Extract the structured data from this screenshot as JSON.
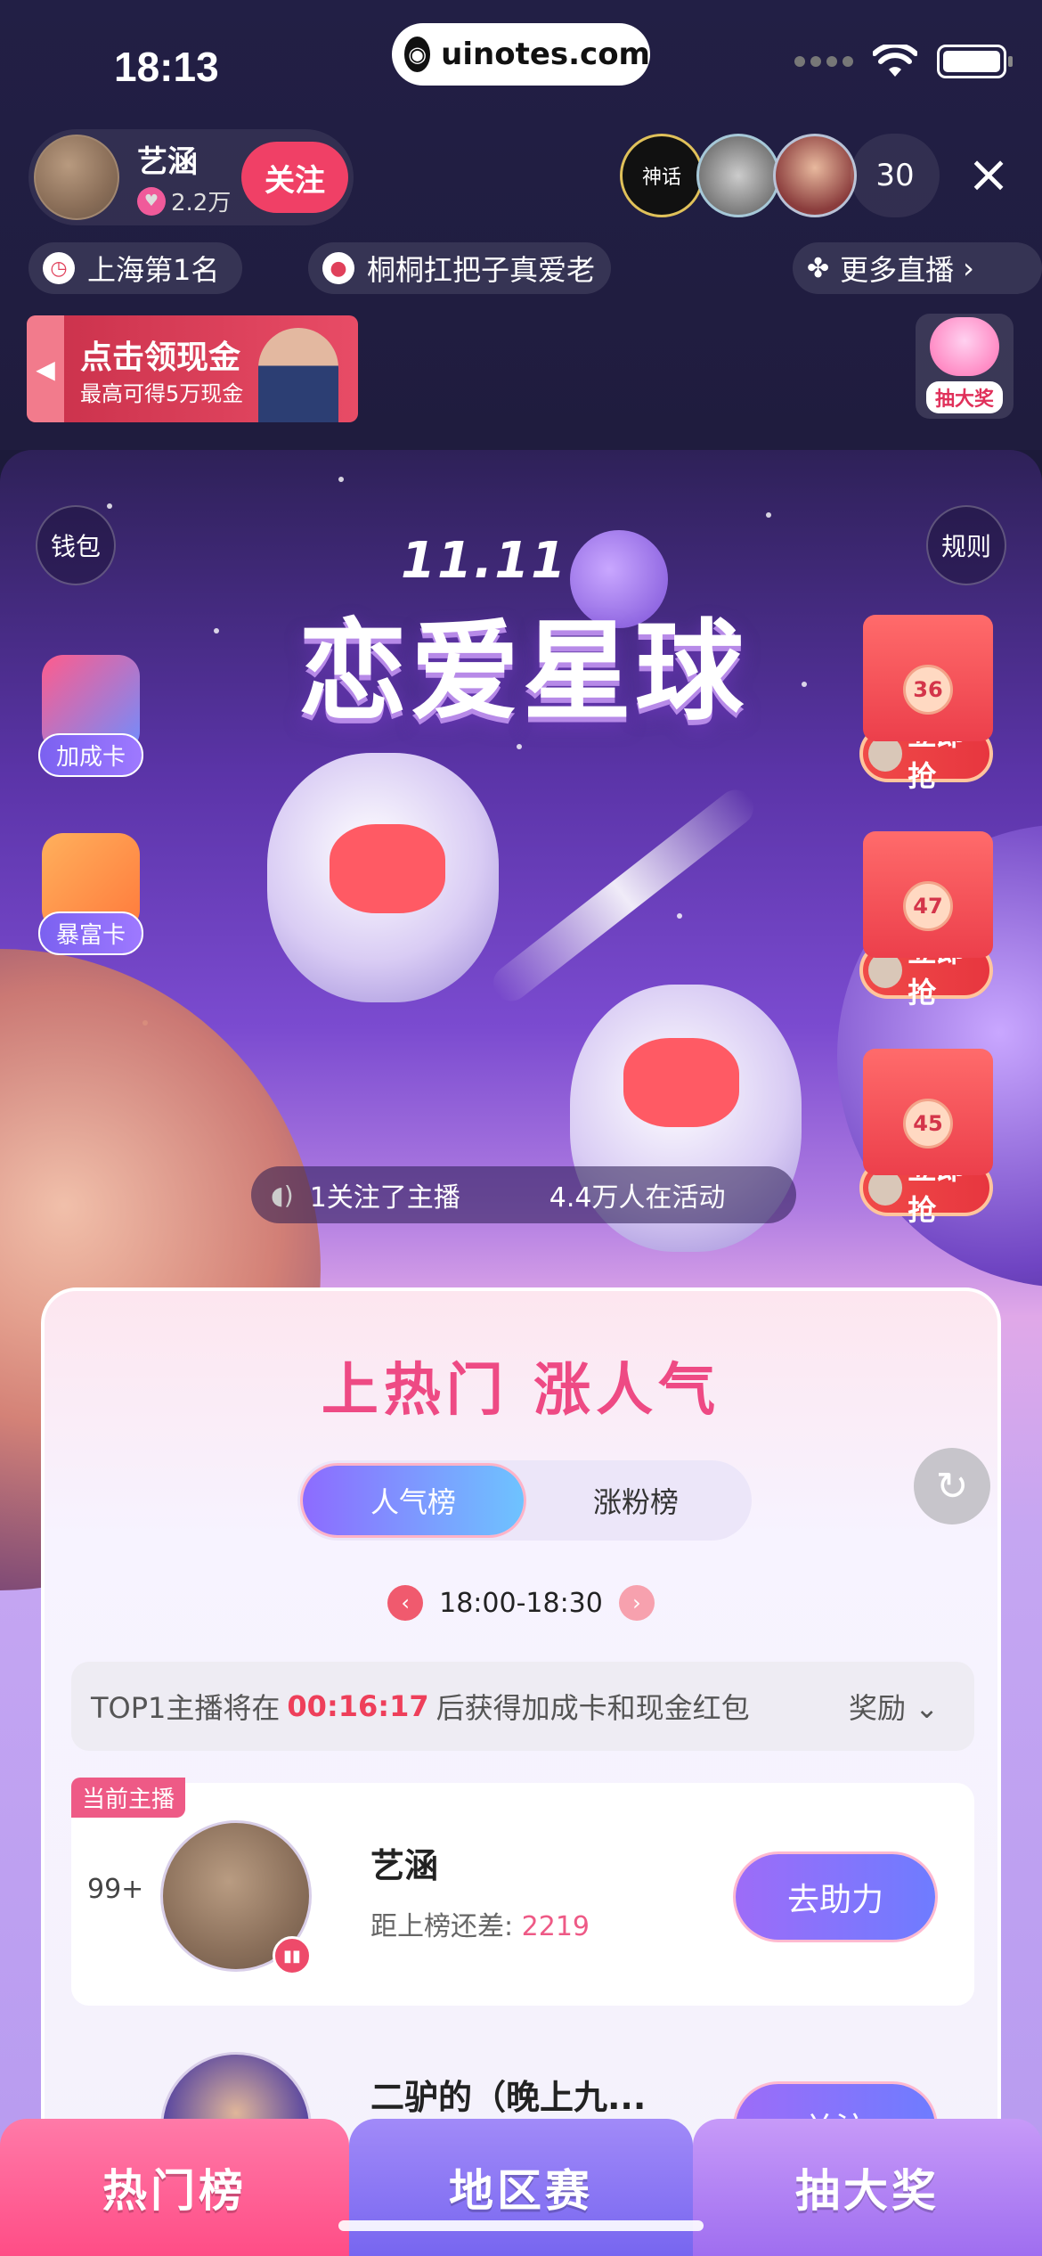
{
  "status_bar": {
    "time": "18:13",
    "url": "uinotes.com"
  },
  "host": {
    "name": "艺涵",
    "likes": "2.2万",
    "follow_label": "关注"
  },
  "viewers": {
    "count": "30",
    "top_avatar_text": "神话"
  },
  "chips": [
    {
      "label": "上海第1名",
      "icon": "clock-icon"
    },
    {
      "label": "桐桐扛把子真爱老",
      "icon": "flame-icon"
    },
    {
      "label": "更多直播",
      "icon": "grid-icon"
    }
  ],
  "cash_banner": {
    "title": "点击领现金",
    "subtitle": "最高可得5万现金"
  },
  "lottery_mini": {
    "label": "抽大奖"
  },
  "event": {
    "wallet_label": "钱包",
    "rules_label": "规则",
    "date_label": "11.11",
    "title": "恋爱星球",
    "boost_card_label": "加成卡",
    "rich_card_label": "暴富卡",
    "ticker_msg_1": "1关注了主播",
    "ticker_msg_2": "4.4万人在活动"
  },
  "red_packets": [
    {
      "count": "36",
      "label": "立即抢"
    },
    {
      "count": "47",
      "label": "立即抢"
    },
    {
      "count": "45",
      "label": "立即抢"
    }
  ],
  "ranking": {
    "title": "上热门 涨人气",
    "tabs": {
      "popularity": "人气榜",
      "fans": "涨粉榜"
    },
    "time_range": "18:00-18:30",
    "notice_prefix": "TOP1主播将在",
    "countdown": "00:16:17",
    "notice_suffix": "后获得加成卡和现金红包",
    "rewards_label": "奖励",
    "rows": [
      {
        "tag": "当前主播",
        "rank": "99+",
        "name": "艺涵",
        "gap_label": "距上榜还差: ",
        "gap_value": "2219",
        "button": "去助力"
      },
      {
        "name": "二驴的（晚上九...",
        "button": "关注"
      }
    ]
  },
  "bottom_tabs": {
    "hot": "热门榜",
    "region": "地区赛",
    "lottery": "抽大奖"
  },
  "colors": {
    "accent_pink": "#ee4a84",
    "follow_red": "#f04066",
    "countdown_red": "#ee3f5a",
    "tab_purple": "#8d6bff"
  }
}
